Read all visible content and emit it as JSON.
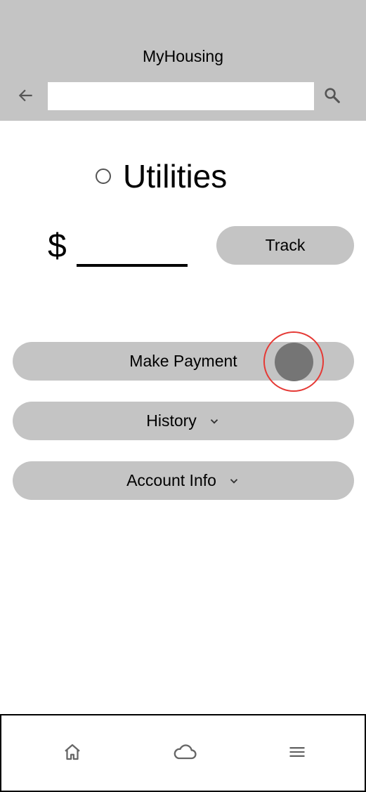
{
  "header": {
    "title": "MyHousing",
    "back_icon": "arrow-left-icon",
    "search_icon": "search-icon",
    "search_value": "",
    "search_placeholder": ""
  },
  "utilities": {
    "title": "Utilities",
    "radio_selected": false
  },
  "amount": {
    "currency_symbol": "$",
    "value": ""
  },
  "buttons": {
    "track_label": "Track",
    "make_payment_label": "Make Payment",
    "history_label": "History",
    "account_info_label": "Account Info"
  },
  "bottom_nav": {
    "items": [
      {
        "icon": "home-icon"
      },
      {
        "icon": "cloud-icon"
      },
      {
        "icon": "menu-icon"
      }
    ]
  },
  "colors": {
    "header_bg": "#c4c4c4",
    "button_bg": "#c4c4c4",
    "touch_indicator": "#757575",
    "touch_ring": "#e53935"
  }
}
